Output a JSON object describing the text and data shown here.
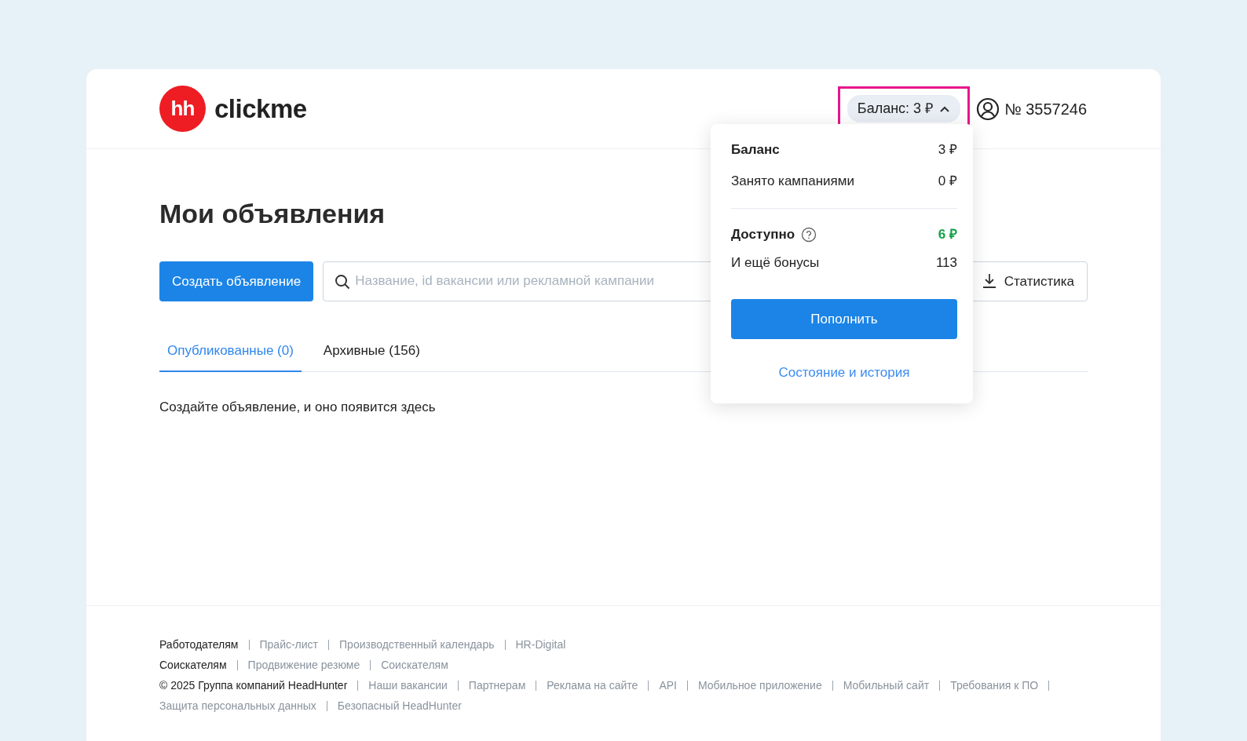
{
  "header": {
    "logo_mark": "hh",
    "logo_text": "clickme",
    "balance_button": {
      "label": "Баланс: 3 ₽",
      "expanded": true
    },
    "account": "№ 3557246"
  },
  "balance_menu": {
    "rows": [
      {
        "label": "Баланс",
        "value": "3 ₽",
        "kind": "total"
      },
      {
        "label": "Занято кампаниями",
        "value": "0 ₽",
        "kind": "plain"
      },
      {
        "label": "Доступно",
        "value": "6 ₽",
        "kind": "available"
      },
      {
        "label": "И ещё бонусы",
        "value": "113",
        "kind": "plain"
      }
    ],
    "primary_button": "Пополнить",
    "link": "Состояние и история"
  },
  "page_title": "Мои объявления",
  "toolbar": {
    "create_button": "Создать объявление",
    "search": {
      "placeholder": "Название, id вакансии или рекламной кампании"
    },
    "stats_button": "Статистика"
  },
  "tabs": [
    {
      "label": "Опубликованные (0)",
      "selected": true
    },
    {
      "label": "Архивные (156)",
      "selected": false
    }
  ],
  "empty_message": "Создайте объявление, и оно появится здесь",
  "footer": {
    "rows": [
      {
        "items": [
          {
            "text": "Работодателям",
            "kind": "title"
          },
          {
            "text": "Прайс-лист",
            "kind": "link"
          },
          {
            "text": "Производственный календарь",
            "kind": "link"
          },
          {
            "text": "HR-Digital",
            "kind": "link"
          }
        ]
      },
      {
        "items": [
          {
            "text": "Соискателям",
            "kind": "title"
          },
          {
            "text": "Продвижение резюме",
            "kind": "link"
          },
          {
            "text": "Соискателям",
            "kind": "link"
          }
        ]
      },
      {
        "items": [
          {
            "text": "© 2025 Группа компаний HeadHunter",
            "kind": "title"
          },
          {
            "text": "Наши вакансии",
            "kind": "link"
          },
          {
            "text": "Партнерам",
            "kind": "link"
          },
          {
            "text": "Реклама на сайте",
            "kind": "link"
          },
          {
            "text": "API",
            "kind": "link"
          },
          {
            "text": "Мобильное приложение",
            "kind": "link"
          },
          {
            "text": "Мобильный сайт",
            "kind": "link"
          },
          {
            "text": "Требования к ПО",
            "kind": "link"
          },
          {
            "text": "Защита персональных данных",
            "kind": "link"
          },
          {
            "text": "Безопасный HeadHunter",
            "kind": "link"
          }
        ]
      }
    ]
  }
}
